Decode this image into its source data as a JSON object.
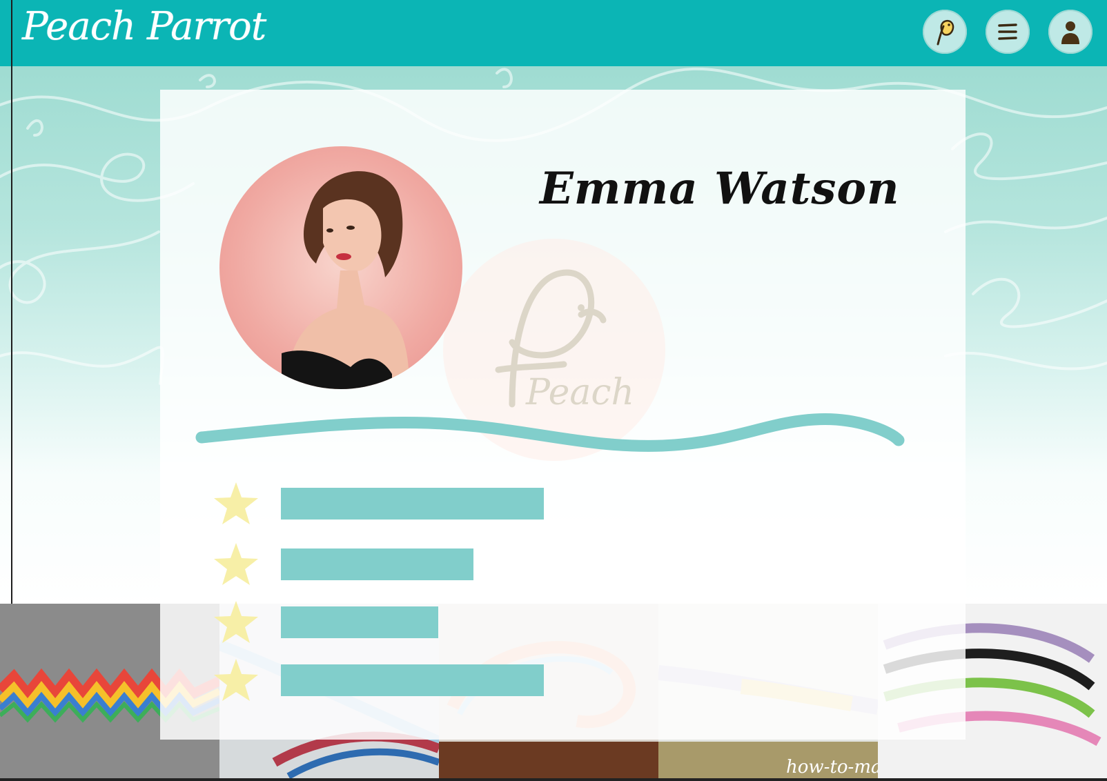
{
  "header": {
    "logo_first": "Peach",
    "logo_second": "Parrot",
    "brand_color": "#0bb5b5"
  },
  "header_buttons": [
    {
      "name": "peach-parrot-icon"
    },
    {
      "name": "menu-icon"
    },
    {
      "name": "user-icon"
    }
  ],
  "profile": {
    "name": "Emma Watson",
    "avatar_background": "#f0a9a2",
    "watermark_text": "Peach"
  },
  "skills": [
    {
      "icon": "star-icon",
      "level": 0.82
    },
    {
      "icon": "star-icon",
      "level": 0.6
    },
    {
      "icon": "star-icon",
      "level": 0.49
    },
    {
      "icon": "star-icon",
      "level": 0.82
    }
  ],
  "strip_watermark": "how-to-make",
  "colors": {
    "accent_teal": "#81cecb",
    "star_yellow": "#f7efa7",
    "header_teal": "#0bb5b5"
  }
}
